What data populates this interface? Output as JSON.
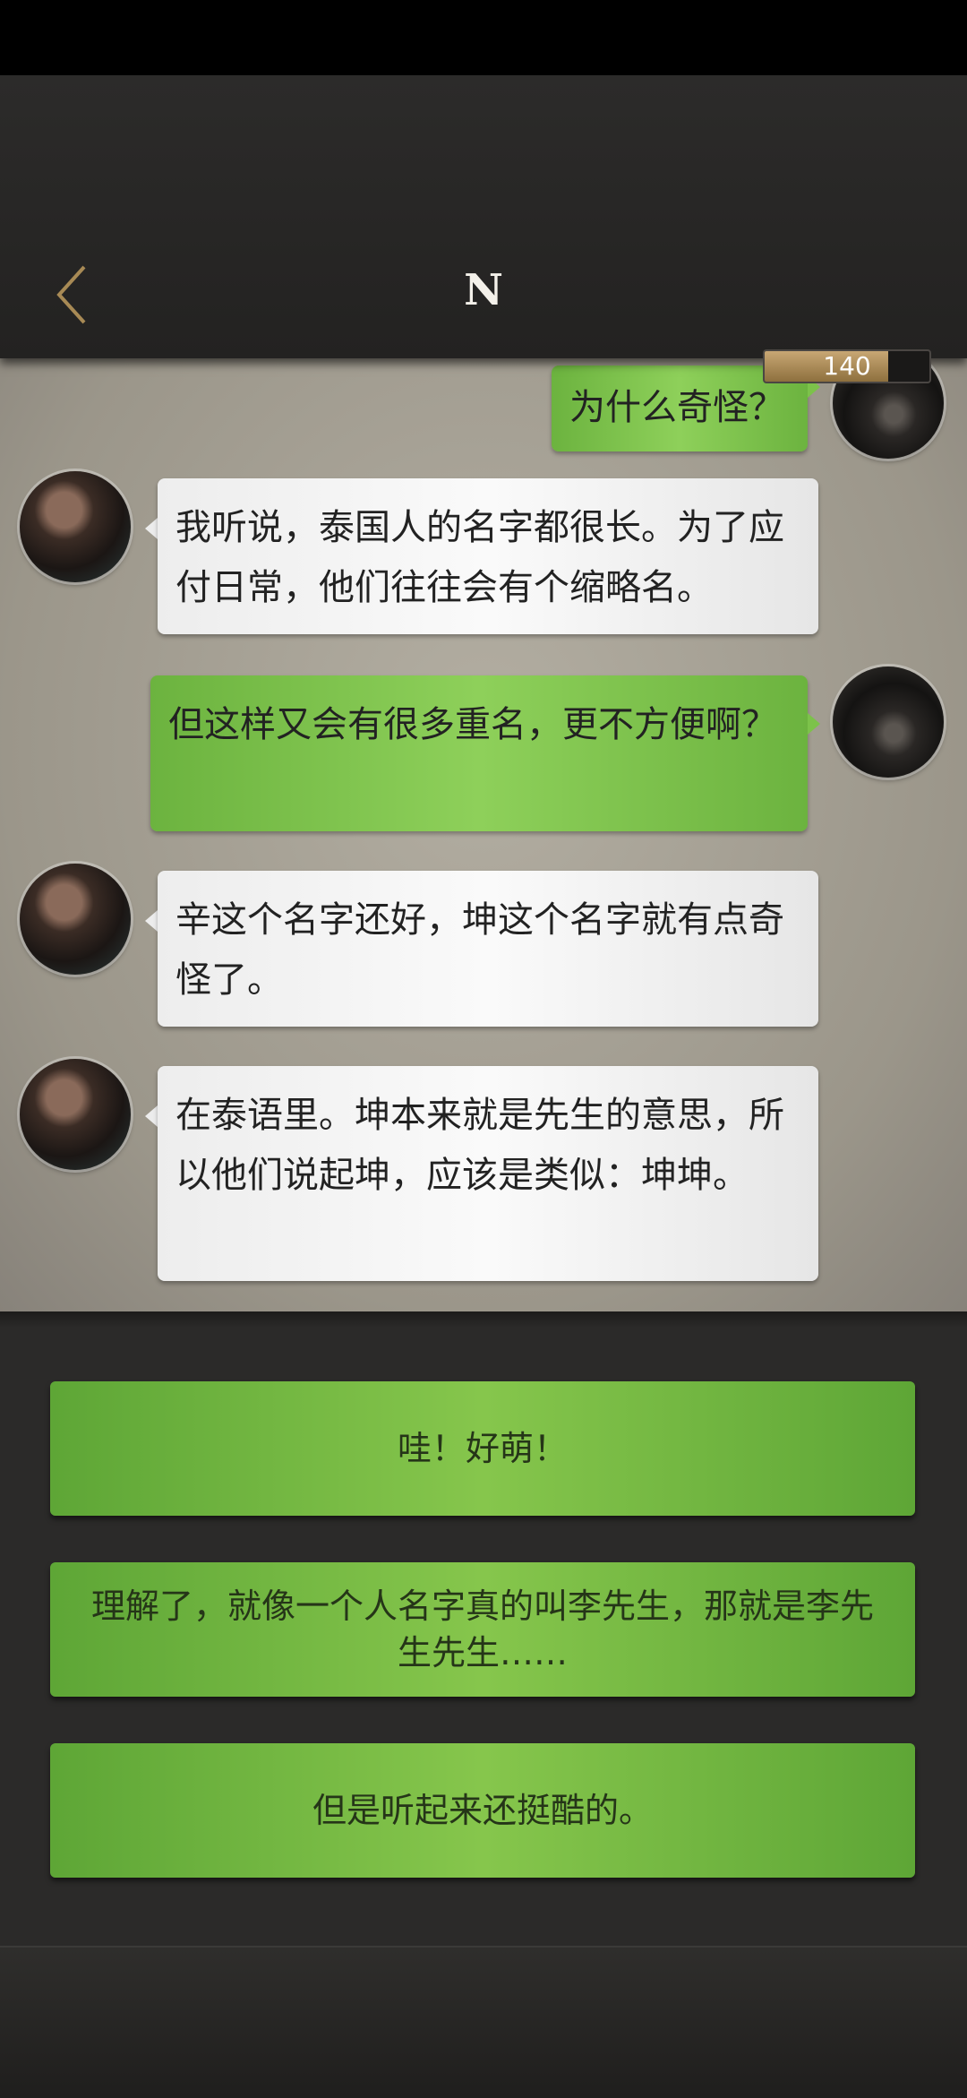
{
  "header": {
    "title": "N",
    "energy_value": "140",
    "energy_fraction": 0.75,
    "back_icon": "chevron-left-icon"
  },
  "messages": [
    {
      "sender": "self",
      "text": "为什么奇怪？"
    },
    {
      "sender": "npc",
      "text": "我听说，泰国人的名字都很长。为了应付日常，他们往往会有个缩略名。"
    },
    {
      "sender": "self",
      "text": "但这样又会有很多重名，更不方便啊？"
    },
    {
      "sender": "npc",
      "text": "辛这个名字还好，坤这个名字就有点奇怪了。"
    },
    {
      "sender": "npc",
      "text": "在泰语里。坤本来就是先生的意思，所以他们说起坤，应该是类似：坤坤。"
    }
  ],
  "choices": [
    {
      "label": "哇！好萌！"
    },
    {
      "label": "理解了，就像一个人名字真的叫李先生，那就是李先生先生……"
    },
    {
      "label": "但是听起来还挺酷的。"
    }
  ],
  "colors": {
    "self_bubble": "#7cc24a",
    "npc_bubble": "#f4f4f4",
    "choice_button": "#76b843",
    "energy_fill": "#b8935a"
  }
}
